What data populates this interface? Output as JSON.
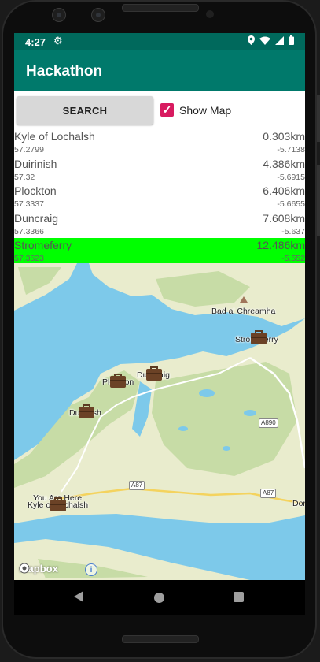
{
  "status_bar": {
    "time": "4:27",
    "icons": [
      "settings-icon",
      "location-icon",
      "wifi-icon",
      "signal-icon",
      "battery-icon"
    ]
  },
  "app_bar": {
    "title": "Hackathon"
  },
  "controls": {
    "search_label": "SEARCH",
    "show_map_label": "Show Map",
    "show_map_checked": true
  },
  "locations": [
    {
      "name": "Kyle of Lochalsh",
      "distance": "0.303km",
      "lat": "57.2799",
      "lon": "-5.7138",
      "selected": false
    },
    {
      "name": "Duirinish",
      "distance": "4.386km",
      "lat": "57.32",
      "lon": "-5.6915",
      "selected": false
    },
    {
      "name": "Plockton",
      "distance": "6.406km",
      "lat": "57.3337",
      "lon": "-5.6655",
      "selected": false
    },
    {
      "name": "Duncraig",
      "distance": "7.608km",
      "lat": "57.3366",
      "lon": "-5.637",
      "selected": false
    },
    {
      "name": "Stromeferry",
      "distance": "12.486km",
      "lat": "57.3523",
      "lon": "-5.552",
      "selected": true
    }
  ],
  "map": {
    "place_labels": {
      "bad_a_chreamha": "Bad a' Chreamha",
      "you_are_here": "You Are Here",
      "dor": "Dor"
    },
    "road_badges": {
      "a890": "A890",
      "a87_left": "A87",
      "a87_right": "A87"
    },
    "attribution": "mapbox",
    "colors": {
      "water": "#7dc9ea",
      "land": "#e9eccd",
      "green": "#c7dca6",
      "highlight": "#00ff00",
      "accent": "#00796b",
      "checkbox": "#d81b60"
    }
  }
}
